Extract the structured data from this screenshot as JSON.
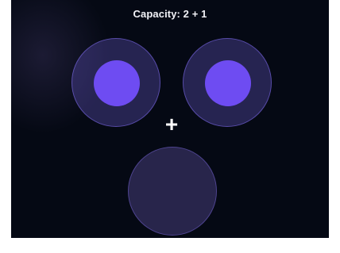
{
  "header": {
    "capacity_text": "Capacity: 2 + 1"
  },
  "slots": {
    "primary": [
      {
        "name": "slot-left",
        "filled": true
      },
      {
        "name": "slot-right",
        "filled": true
      }
    ],
    "extra": {
      "name": "slot-bottom",
      "filled": false
    }
  },
  "operator": {
    "symbol": "+"
  },
  "colors": {
    "background": "#050914",
    "slot_fill": "#6e4cf2",
    "slot_ring": "#6c5cd2"
  }
}
